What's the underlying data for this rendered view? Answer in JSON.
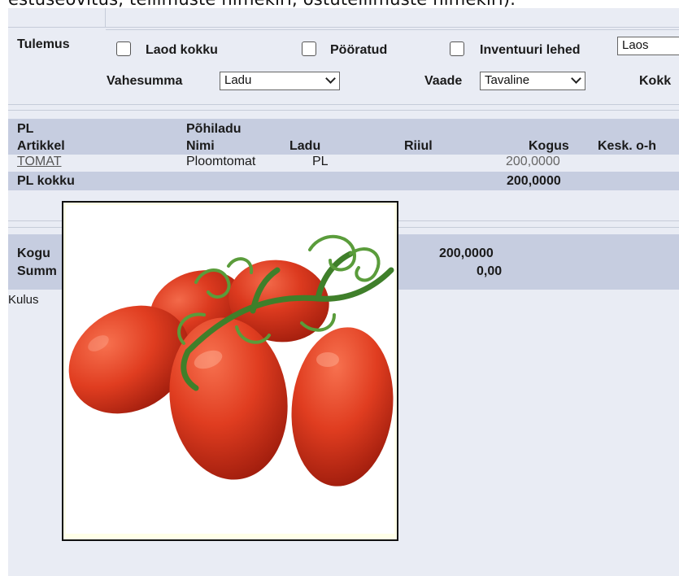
{
  "top_text": "estuseovitus, tellimuste nimekiri, ostutellimuste nimekiri).",
  "form": {
    "tulemus_label": "Tulemus",
    "checkbox_laod_kokku": "Laod kokku",
    "checkbox_pooratud": "Pööratud",
    "checkbox_inventuuri_lehed": "Inventuuri lehed",
    "inventuuri_select_value": "Laos",
    "vahesumma_label": "Vahesumma",
    "vahesumma_value": "Ladu",
    "vaade_label": "Vaade",
    "vaade_value": "Tavaline",
    "kokku_label": "Kokk"
  },
  "report": {
    "group_code": "PL",
    "group_name": "Põhiladu",
    "columns": [
      "Artikkel",
      "Nimi",
      "Ladu",
      "Riiul",
      "Kogus",
      "Kesk. o-h"
    ],
    "rows": [
      {
        "artikkel": "TOMAT",
        "nimi": "Ploomtomat",
        "ladu": "PL",
        "riiul": "",
        "kogus": "200,0000"
      }
    ],
    "subtotal_label": "PL kokku",
    "subtotal_kogus": "200,0000",
    "total_label_1": "Kogu",
    "total_value_1": "200,0000",
    "total_label_2": "Summ",
    "total_value_2": "0,00",
    "footer_text": "Kulus"
  },
  "popup": {
    "image_subject": "roma tomatoes on vine",
    "colors": {
      "tomato": "#d8321a",
      "vine": "#3f7f2a",
      "border": "#111111"
    }
  }
}
